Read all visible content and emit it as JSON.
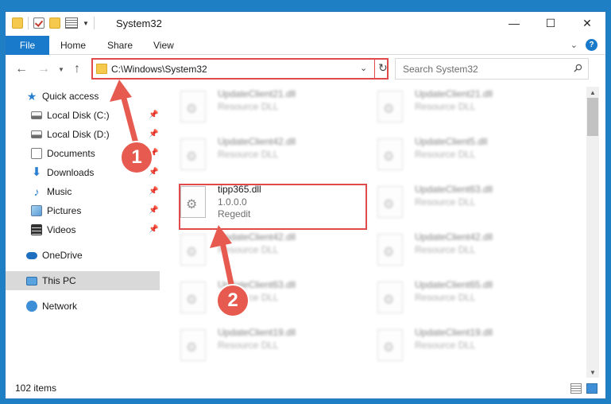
{
  "window": {
    "title": "System32",
    "controls": {
      "minimize": "—",
      "maximize": "☐",
      "close": "✕"
    }
  },
  "ribbon": {
    "file_tab": "File",
    "tabs": [
      "Home",
      "Share",
      "View"
    ]
  },
  "address_bar": {
    "path": "C:\\Windows\\System32",
    "search_placeholder": "Search System32"
  },
  "sidebar": {
    "quick_access": "Quick access",
    "items": [
      {
        "label": "Local Disk (C:)",
        "icon": "disk-icon",
        "pinned": true
      },
      {
        "label": "Local Disk (D:)",
        "icon": "disk-icon",
        "pinned": true
      },
      {
        "label": "Documents",
        "icon": "documents-icon",
        "pinned": true
      },
      {
        "label": "Downloads",
        "icon": "downloads-icon",
        "pinned": true
      },
      {
        "label": "Music",
        "icon": "music-icon",
        "pinned": true
      },
      {
        "label": "Pictures",
        "icon": "pictures-icon",
        "pinned": true
      },
      {
        "label": "Videos",
        "icon": "videos-icon",
        "pinned": true
      }
    ],
    "onedrive": "OneDrive",
    "this_pc": "This PC",
    "network": "Network"
  },
  "files": {
    "left_column": [
      {
        "name": "UpdateClient21.dll",
        "desc": "Resource DLL"
      },
      {
        "name": "UpdateClient42.dll",
        "desc": "Resource DLL"
      },
      {
        "name": "tipp365.dll",
        "version": "1.0.0.0",
        "desc": "Regedit",
        "highlighted": true
      },
      {
        "name": "UpdateClient42.dll",
        "desc": "Resource DLL"
      },
      {
        "name": "UpdateClient63.dll",
        "desc": "Resource DLL"
      },
      {
        "name": "UpdateClient19.dll",
        "desc": "Resource DLL"
      }
    ],
    "right_column": [
      {
        "name": "UpdateClient21.dll",
        "desc": "Resource DLL"
      },
      {
        "name": "UpdateClient5.dll",
        "desc": "Resource DLL"
      },
      {
        "name": "UpdateClient63.dll",
        "desc": "Resource DLL"
      },
      {
        "name": "UpdateClient42.dll",
        "desc": "Resource DLL"
      },
      {
        "name": "UpdateClient65.dll",
        "desc": "Resource DLL"
      },
      {
        "name": "UpdateClient19.dll",
        "desc": "Resource DLL"
      }
    ]
  },
  "status_bar": {
    "item_count": "102 items"
  },
  "annotations": {
    "step1": "1",
    "step2": "2"
  },
  "colors": {
    "accent": "#1979ca",
    "highlight_border": "#e04a4a",
    "annotation": "#e65a4f",
    "desktop": "#1e7fc4"
  }
}
